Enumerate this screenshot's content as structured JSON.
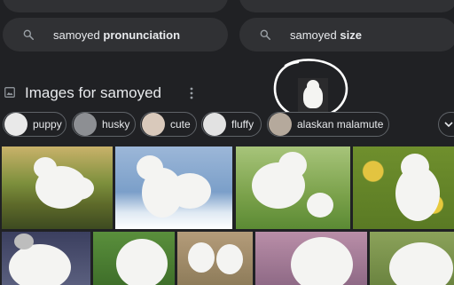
{
  "suggestions": [
    {
      "prefix": "samoyed ",
      "bold": "pronunciation"
    },
    {
      "prefix": "samoyed ",
      "bold": "size"
    }
  ],
  "section": {
    "title": "Images for samoyed"
  },
  "chips": [
    {
      "label": "puppy"
    },
    {
      "label": "husky"
    },
    {
      "label": "cute"
    },
    {
      "label": "fluffy"
    },
    {
      "label": "alaskan malamute"
    }
  ],
  "colors": {
    "background": "#202124",
    "pill": "#303134",
    "chip_border": "#5f6368",
    "text": "#e8eaed",
    "icon": "#9aa0a6",
    "annotation_circle": "#ffffff"
  },
  "icons": [
    "search-icon",
    "image-icon",
    "more-vert-icon",
    "chevron-right-icon"
  ]
}
